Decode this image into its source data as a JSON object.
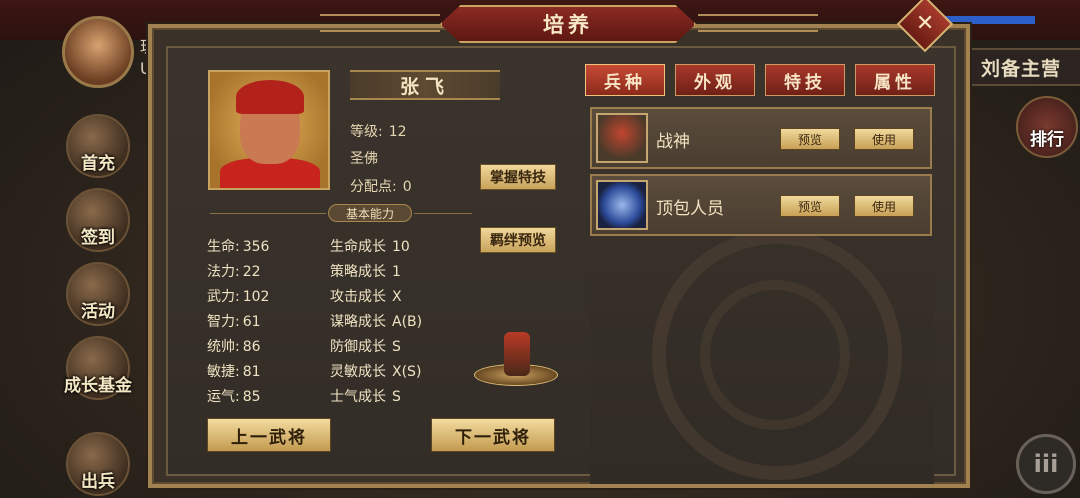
{
  "title": "培养",
  "close_icon": "close-icon",
  "background": {
    "right_banner": "刘备主营",
    "avatar_text_line1": "玩",
    "avatar_text_line2": "UID",
    "side_buttons": [
      "首充",
      "签到",
      "活动",
      "成长基金",
      "出兵"
    ],
    "right_button": "排行",
    "menu_button": "iii"
  },
  "general": {
    "name": "张飞",
    "level_label": "等级:",
    "level_value": "12",
    "rank": "圣佛",
    "points_label": "分配点:",
    "points_value": "0"
  },
  "buttons": {
    "master_skill": "掌握特技",
    "bond_preview": "羁绊预览",
    "prev_general": "上一武将",
    "next_general": "下一武将"
  },
  "section_label": "基本能力",
  "stats": [
    {
      "label": "生命:",
      "value": "356"
    },
    {
      "label": "法力:",
      "value": "22"
    },
    {
      "label": "武力:",
      "value": "102"
    },
    {
      "label": "智力:",
      "value": "61"
    },
    {
      "label": "统帅:",
      "value": "86"
    },
    {
      "label": "敏捷:",
      "value": "81"
    },
    {
      "label": "运气:",
      "value": "85"
    }
  ],
  "growth": [
    {
      "label": "生命成长",
      "value": "10"
    },
    {
      "label": "策略成长",
      "value": "1"
    },
    {
      "label": "攻击成长",
      "value": "X"
    },
    {
      "label": "谋略成长",
      "value": "A(B)"
    },
    {
      "label": "防御成长",
      "value": "S"
    },
    {
      "label": "灵敏成长",
      "value": "X(S)"
    },
    {
      "label": "士气成长",
      "value": "S"
    }
  ],
  "tabs": [
    "兵种",
    "外观",
    "特技",
    "属性"
  ],
  "items": [
    {
      "name": "战神",
      "preview": "预览",
      "use": "使用",
      "icon": "warrior-icon"
    },
    {
      "name": "顶包人员",
      "preview": "预览",
      "use": "使用",
      "icon": "blue-orb-icon"
    }
  ],
  "colors": {
    "panel_border": "#a28250",
    "tab_red": "#a8382a",
    "gold_button": "#e8c986"
  }
}
